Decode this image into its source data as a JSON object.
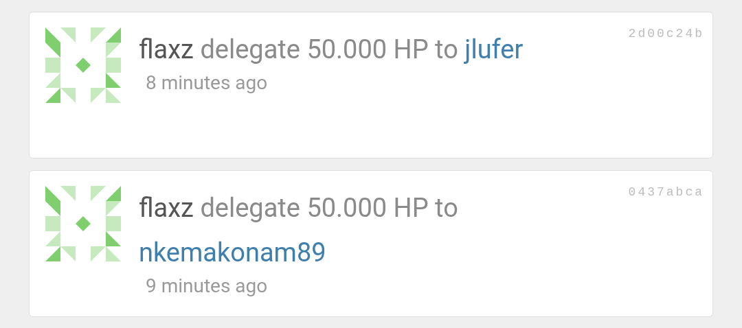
{
  "operations": [
    {
      "author": "flaxz",
      "action": "delegate 50.000 HP to",
      "target": "jlufer",
      "time": "8 minutes ago",
      "hash": "2d00c24b"
    },
    {
      "author": "flaxz",
      "action": "delegate 50.000 HP to",
      "target": "nkemakonam89",
      "time": "9 minutes ago",
      "hash": "0437abca"
    }
  ]
}
